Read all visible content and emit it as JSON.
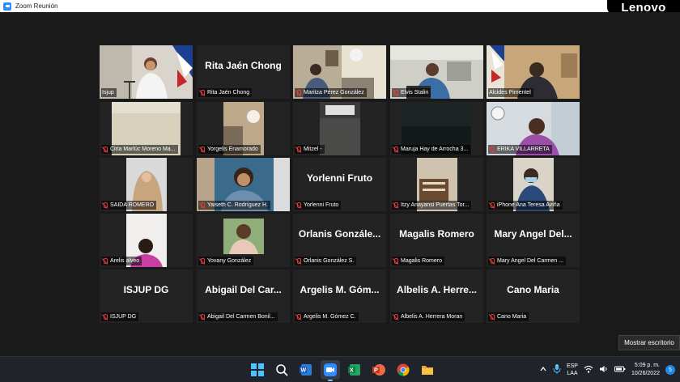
{
  "window": {
    "title": "Zoom Reunión",
    "brand": "Lenovo"
  },
  "participants": [
    {
      "label": "Isjup",
      "display": "",
      "active": true,
      "muted": false
    },
    {
      "label": "Rita Jaén Chong",
      "display": "Rita Jaén Chong",
      "muted": true
    },
    {
      "label": "Maritza Pérez  González",
      "display": "",
      "muted": true
    },
    {
      "label": "Elvis Stalin",
      "display": "",
      "muted": true
    },
    {
      "label": "Alcides Pimentel",
      "display": "",
      "muted": false
    },
    {
      "label": "Ciria Marlúc Moreno Ma...",
      "display": "",
      "muted": true
    },
    {
      "label": "Yorgelis Enamorado",
      "display": "",
      "muted": true
    },
    {
      "label": "Mitzel -",
      "display": "",
      "muted": true
    },
    {
      "label": "Maruja Hay de Arrocha 3...",
      "display": "",
      "muted": true
    },
    {
      "label": "ERIKA VILLARRETA",
      "display": "",
      "muted": true
    },
    {
      "label": "SAIDA ROMERO",
      "display": "",
      "muted": true
    },
    {
      "label": "Yaiseth C. Rodríguez H.",
      "display": "",
      "muted": true
    },
    {
      "label": "Yorlenni Fruto",
      "display": "Yorlenni Fruto",
      "muted": true
    },
    {
      "label": "Itzy Anayansi Puertas Tor...",
      "display": "",
      "muted": true
    },
    {
      "label": "iPhone Ana Teresa Aviña",
      "display": "",
      "muted": true
    },
    {
      "label": "Arelis alveo",
      "display": "",
      "muted": true
    },
    {
      "label": "Yovany González",
      "display": "",
      "muted": true
    },
    {
      "label": "Orlanis González S.",
      "display": "Orlanis Gonzále...",
      "muted": true
    },
    {
      "label": "Magalis Romero",
      "display": "Magalis Romero",
      "muted": true
    },
    {
      "label": "Mary Angel Del Carmen ...",
      "display": "Mary Angel Del...",
      "muted": true
    },
    {
      "label": "ISJUP DG",
      "display": "ISJUP DG",
      "muted": true
    },
    {
      "label": "Abigail Del Carmen Bonil...",
      "display": "Abigail Del Car...",
      "muted": true
    },
    {
      "label": "Argelis M. Gómez C.",
      "display": "Argelis M. Góm...",
      "muted": true
    },
    {
      "label": "Albelis A. Herrera Moran",
      "display": "Albelis A. Herre...",
      "muted": true
    },
    {
      "label": "Cano Maria",
      "display": "Cano Maria",
      "muted": true
    }
  ],
  "mostrar_escritorio": "Mostrar escritorio",
  "taskbar": {
    "apps": [
      "windows-start",
      "search",
      "word",
      "zoom",
      "excel",
      "powerpoint",
      "chrome",
      "file-explorer"
    ],
    "active_app": "zoom",
    "lang_line1": "ESP",
    "lang_line2": "LAA",
    "time": "5:09 p. m.",
    "date": "10/26/2022",
    "notifications": "5"
  },
  "colors": {
    "active_border": "#c8e84e",
    "muted_red": "#e03c3c",
    "taskbar": "#20232a",
    "background": "#1a1a1a"
  }
}
